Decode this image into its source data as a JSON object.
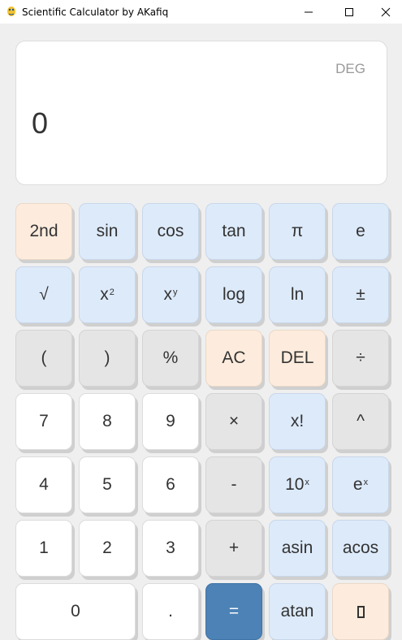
{
  "window": {
    "title": "Scientific Calculator by AKafiq",
    "minimize_glyph": "—",
    "maximize_glyph": "☐",
    "close_glyph": "✕",
    "icon": "pygame-snake-icon"
  },
  "display": {
    "mode": "DEG",
    "value": "0"
  },
  "keys": {
    "second": "2nd",
    "sin": "sin",
    "cos": "cos",
    "tan": "tan",
    "pi": "π",
    "e": "e",
    "sqrt": "√",
    "x_sq_base": "x",
    "x_sq_sup": "2",
    "x_y_base": "x",
    "x_y_sup": "y",
    "log": "log",
    "ln": "ln",
    "plus_minus": "±",
    "lparen": "(",
    "rparen": ")",
    "percent": "%",
    "ac": "AC",
    "del": "DEL",
    "divide": "÷",
    "seven": "7",
    "eight": "8",
    "nine": "9",
    "multiply": "×",
    "factorial": "x!",
    "power": "^",
    "four": "4",
    "five": "5",
    "six": "6",
    "minus": "-",
    "ten_x_base": "10",
    "ten_x_sup": "x",
    "e_x_base": "e",
    "e_x_sup": "x",
    "one": "1",
    "two": "2",
    "three": "3",
    "plus": "+",
    "asin": "asin",
    "acos": "acos",
    "zero": "0",
    "dot": ".",
    "equals": "=",
    "atan": "atan"
  },
  "colors": {
    "function_key": "#ddeafa",
    "special_key": "#fdecdd",
    "operator_key": "#e5e5e5",
    "digit_key": "#ffffff",
    "equals_key": "#4c82b5"
  }
}
